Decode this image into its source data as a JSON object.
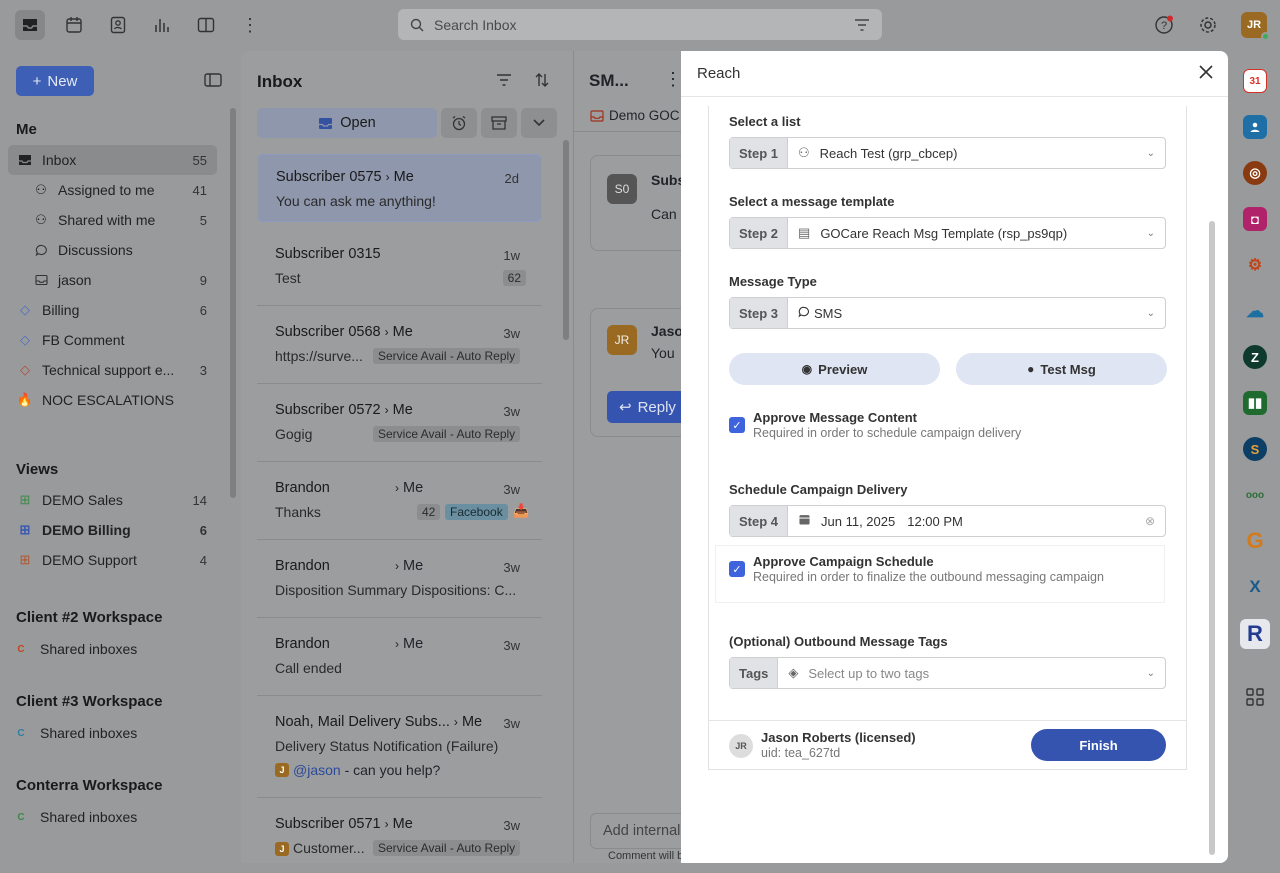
{
  "search": {
    "placeholder": "Search Inbox"
  },
  "user": {
    "initials": "JR"
  },
  "sidebar": {
    "new_label": "New",
    "me_title": "Me",
    "items": [
      {
        "label": "Inbox",
        "count": "55"
      },
      {
        "label": "Assigned to me",
        "count": "41"
      },
      {
        "label": "Shared with me",
        "count": "5"
      },
      {
        "label": "Discussions",
        "count": ""
      },
      {
        "label": "jason",
        "count": "9"
      },
      {
        "label": "Billing",
        "count": "6"
      },
      {
        "label": "FB Comment",
        "count": ""
      },
      {
        "label": "Technical support e...",
        "count": "3"
      },
      {
        "label": "NOC ESCALATIONS",
        "count": ""
      }
    ],
    "views_title": "Views",
    "views": [
      {
        "label": "DEMO Sales",
        "count": "14"
      },
      {
        "label": "DEMO Billing",
        "count": "6"
      },
      {
        "label": "DEMO Support",
        "count": "4"
      }
    ],
    "workspaces": [
      {
        "title": "Client #2 Workspace",
        "item": "Shared inboxes",
        "badge": "C"
      },
      {
        "title": "Client #3 Workspace",
        "item": "Shared inboxes",
        "badge": "C"
      },
      {
        "title": "Conterra Workspace",
        "item": "Shared inboxes",
        "badge": "C"
      }
    ]
  },
  "inbox": {
    "title": "Inbox",
    "open_label": "Open",
    "conversations": [
      {
        "name": "Subscriber 0575",
        "to": "Me",
        "time": "2d",
        "preview": "You can ask me anything!"
      },
      {
        "name": "Subscriber 0315",
        "to": "",
        "time": "1w",
        "preview": "Test",
        "badge": "62"
      },
      {
        "name": "Subscriber 0568",
        "to": "Me",
        "time": "3w",
        "preview": "https://surve...",
        "tag": "Service Avail - Auto Reply"
      },
      {
        "name": "Subscriber 0572",
        "to": "Me",
        "time": "3w",
        "preview": "Gogig",
        "tag": "Service Avail - Auto Reply"
      },
      {
        "name": "Brandon",
        "to": "Me",
        "time": "3w",
        "preview": "Thanks",
        "badge": "42",
        "tag": "Facebook"
      },
      {
        "name": "Brandon",
        "to": "Me",
        "time": "3w",
        "preview": "Disposition Summary Dispositions: C..."
      },
      {
        "name": "Brandon",
        "to": "Me",
        "time": "3w",
        "preview": "Call ended"
      },
      {
        "name": "Noah, Mail Delivery Subs...",
        "to": "Me",
        "time": "3w",
        "preview": "Delivery Status Notification (Failure)",
        "mention": "@jason",
        "mention_rest": "- can you help?"
      },
      {
        "name": "Subscriber 0571",
        "to": "Me",
        "time": "3w",
        "preview": "Customer...",
        "tag": "Service Avail - Auto Reply"
      }
    ]
  },
  "middle": {
    "title": "SM...",
    "tab": "Demo GOC",
    "msg1_initials": "S0",
    "msg1_name": "Subs",
    "msg1_text": "Can",
    "msg2_initials": "JR",
    "msg2_name": "Jaso",
    "msg2_text": "You",
    "reply_label": "Reply",
    "internal_placeholder": "Add internal",
    "comment_note": "Comment will b"
  },
  "modal": {
    "title": "Reach",
    "select_list_label": "Select a list",
    "step1": "Step 1",
    "list_value": "Reach Test (grp_cbcep)",
    "template_label": "Select a message template",
    "step2": "Step 2",
    "template_value": "GOCare Reach Msg Template (rsp_ps9qp)",
    "type_label": "Message Type",
    "step3": "Step 3",
    "type_value": "SMS",
    "preview_label": "Preview",
    "test_label": "Test Msg",
    "approve_content_title": "Approve Message Content",
    "approve_content_sub": "Required in order to schedule campaign delivery",
    "schedule_label": "Schedule Campaign Delivery",
    "step4": "Step 4",
    "date_value": "Jun 11, 2025",
    "time_value": "12:00 PM",
    "approve_schedule_title": "Approve Campaign Schedule",
    "approve_schedule_sub": "Required in order to finalize the outbound messaging campaign",
    "tags_label": "(Optional) Outbound Message Tags",
    "tags_step": "Tags",
    "tags_placeholder": "Select up to two tags",
    "user_initials": "JR",
    "user_name": "Jason Roberts (licensed)",
    "user_uid": "uid: tea_627td",
    "finish_label": "Finish"
  },
  "rail": {
    "calendar_day": "31"
  }
}
